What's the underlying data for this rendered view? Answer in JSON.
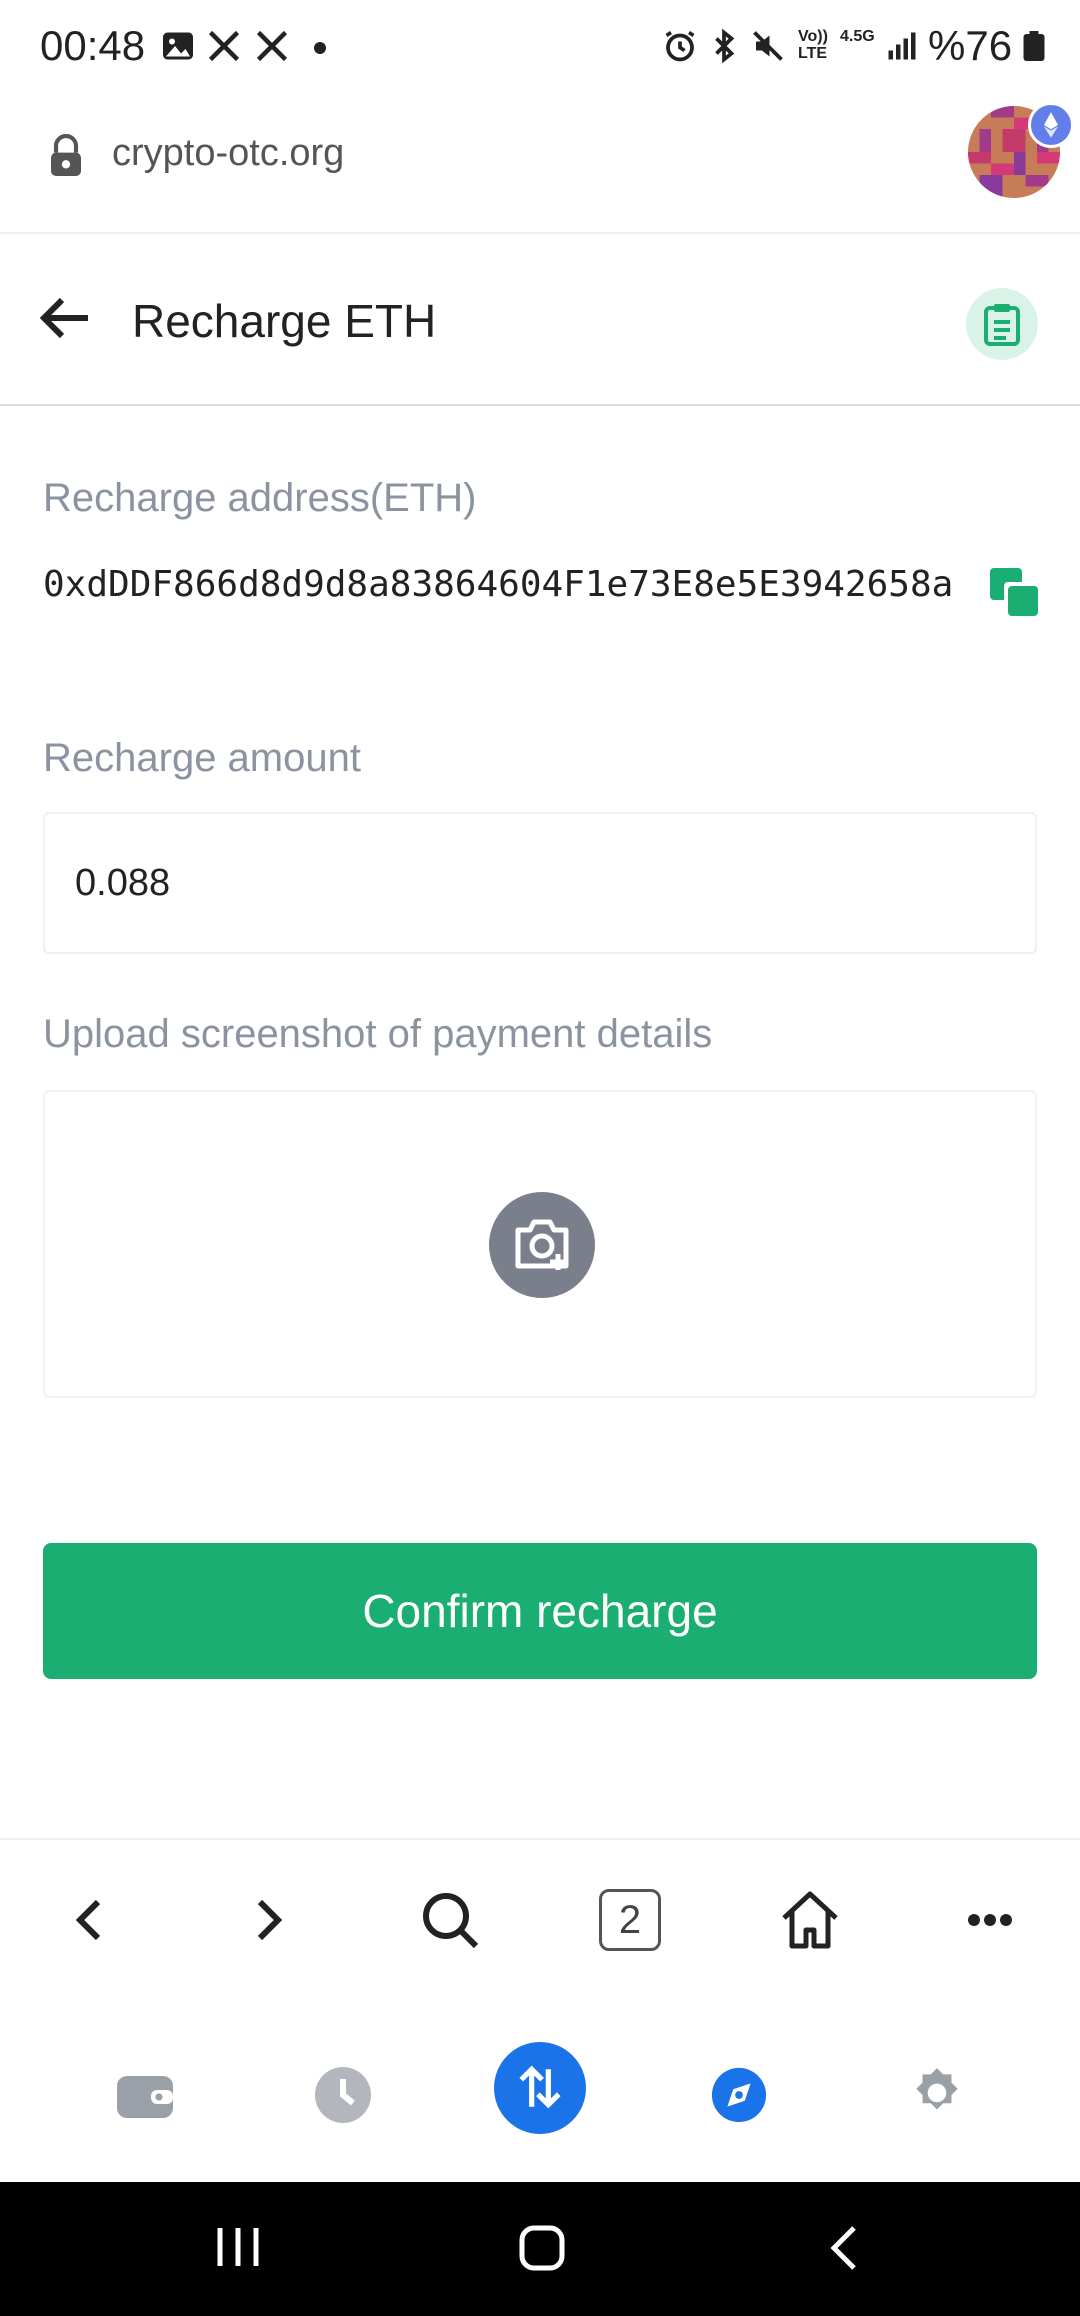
{
  "status_bar": {
    "time": "00:48",
    "battery": "%76",
    "network_labels": [
      "Vo)) LTE",
      "4.5G"
    ]
  },
  "browser": {
    "url": "crypto-otc.org",
    "tab_count": "2"
  },
  "header": {
    "title": "Recharge ETH"
  },
  "form": {
    "address_label": "Recharge address(ETH)",
    "address_value": "0xdDDF866d8d9d8a83864604F1e73E8e5E3942658a",
    "amount_label": "Recharge amount",
    "amount_value": "0.088",
    "upload_label": "Upload screenshot of payment details",
    "confirm_label": "Confirm recharge"
  },
  "colors": {
    "accent_green": "#1aae72",
    "nav_active_blue": "#1a73e8",
    "label_gray": "#8b93a1"
  },
  "icons": {
    "status": [
      "image-icon",
      "x-logo-icon",
      "x-logo-icon",
      "dot-icon",
      "alarm-icon",
      "bluetooth-icon",
      "mute-icon",
      "signal-icon",
      "battery-icon"
    ],
    "browser_bar": [
      "back-icon",
      "forward-icon",
      "search-icon",
      "tabs-icon",
      "home-icon",
      "more-icon"
    ],
    "app_nav": [
      "wallet-icon",
      "history-icon",
      "swap-icon",
      "discover-icon",
      "settings-icon"
    ]
  }
}
